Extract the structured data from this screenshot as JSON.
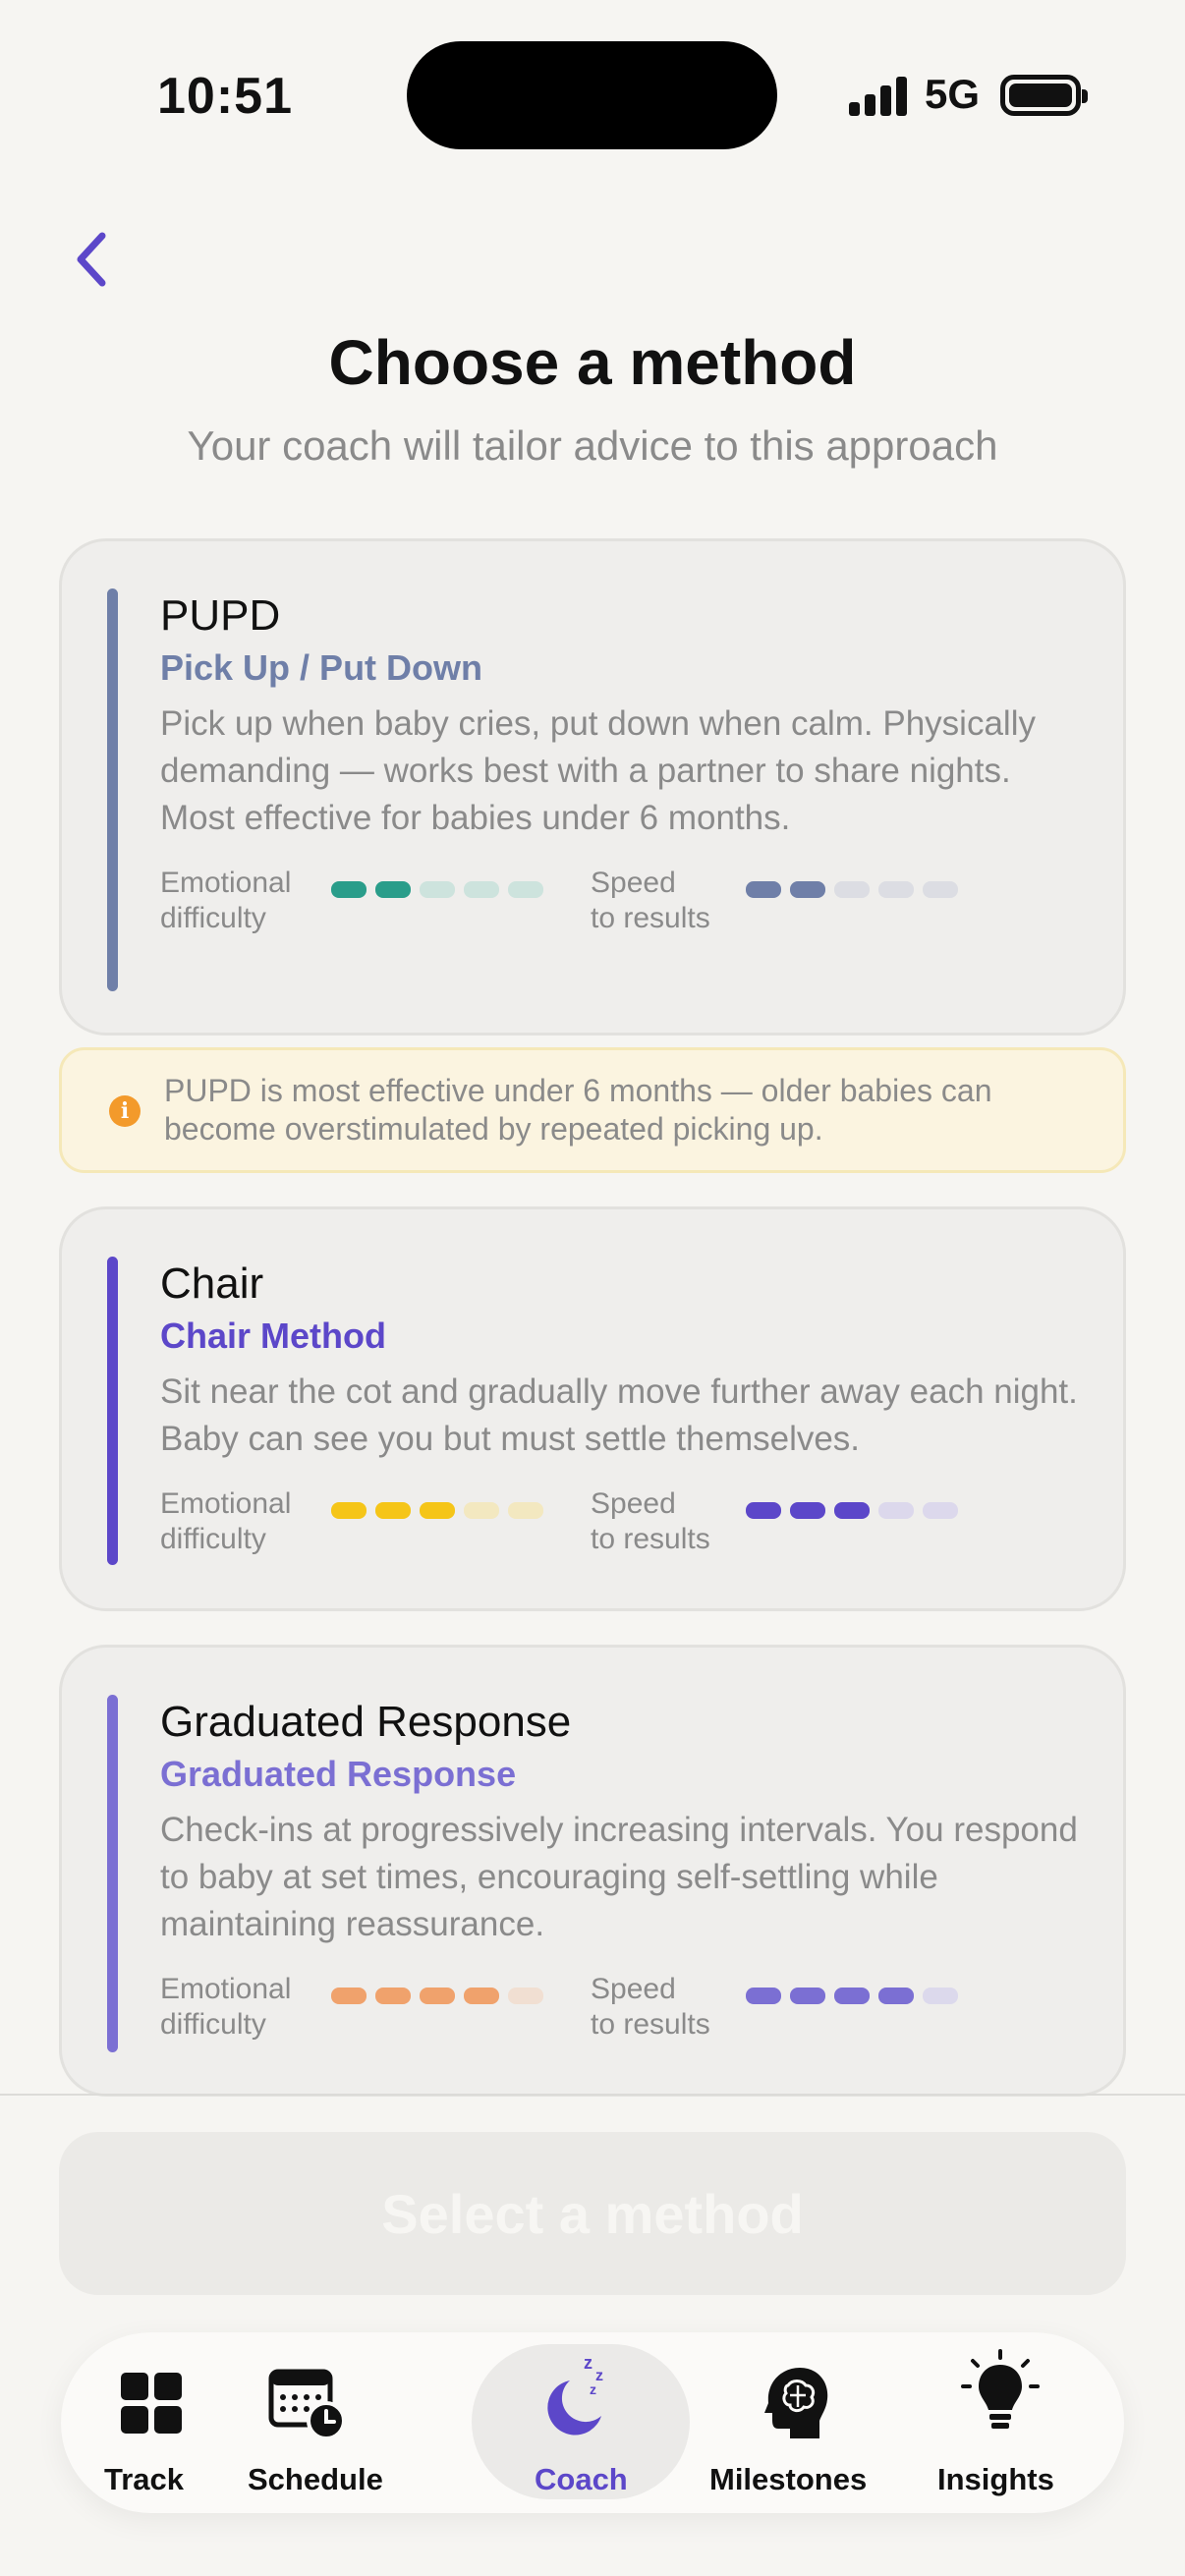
{
  "status": {
    "time": "10:51",
    "network": "5G"
  },
  "page": {
    "title": "Choose a method",
    "subtitle": "Your coach will tailor advice to this approach"
  },
  "methods": [
    {
      "name": "PUPD",
      "full_name": "Pick Up / Put Down",
      "description": "Pick up when baby cries, put down when calm. Physically demanding — works best with a partner to share nights. Most effective for babies under 6 months.",
      "accent_color": "#6f7fa8",
      "emotional_label": "Emotional\ndifficulty",
      "speed_label": "Speed\nto results",
      "emotional_difficulty": 2,
      "emotional_color": "#2a9d8a",
      "emotional_color_light": "#cde3dd",
      "speed_to_results": 2,
      "speed_color": "#6f7fa8",
      "speed_color_light": "#dcdde3",
      "max": 5
    },
    {
      "name": "Chair",
      "full_name": "Chair Method",
      "description": "Sit near the cot and gradually move further away each night. Baby can see you but must settle themselves.",
      "accent_color": "#5c47c9",
      "emotional_label": "Emotional\ndifficulty",
      "speed_label": "Speed\nto results",
      "emotional_difficulty": 3,
      "emotional_color": "#f5c518",
      "emotional_color_light": "#f3e8c0",
      "speed_to_results": 3,
      "speed_color": "#5c47c9",
      "speed_color_light": "#dcd8ec",
      "max": 5
    },
    {
      "name": "Graduated Response",
      "full_name": "Graduated Response",
      "description": "Check-ins at progressively increasing intervals. You respond to baby at set times, encouraging self-settling while maintaining reassurance.",
      "accent_color": "#7b6fd3",
      "emotional_label": "Emotional\ndifficulty",
      "speed_label": "Speed\nto results",
      "emotional_difficulty": 4,
      "emotional_color": "#f0a26c",
      "emotional_color_light": "#f1dfd2",
      "speed_to_results": 4,
      "speed_color": "#7b6fd3",
      "speed_color_light": "#dcd9ec",
      "max": 5
    }
  ],
  "info_note": {
    "icon": "info-icon",
    "text": "PUPD is most effective under 6 months — older babies can become overstimulated by repeated picking up."
  },
  "select_button": {
    "label": "Select a method",
    "enabled": false
  },
  "tabs": [
    {
      "label": "Track",
      "icon": "grid-icon",
      "active": false
    },
    {
      "label": "Schedule",
      "icon": "calendar-clock-icon",
      "active": false
    },
    {
      "label": "Coach",
      "icon": "moon-sleep-icon",
      "active": true
    },
    {
      "label": "Milestones",
      "icon": "brain-head-icon",
      "active": false
    },
    {
      "label": "Insights",
      "icon": "lightbulb-icon",
      "active": false
    }
  ],
  "colors": {
    "accent": "#5c47c9",
    "background": "#f6f5f2"
  }
}
